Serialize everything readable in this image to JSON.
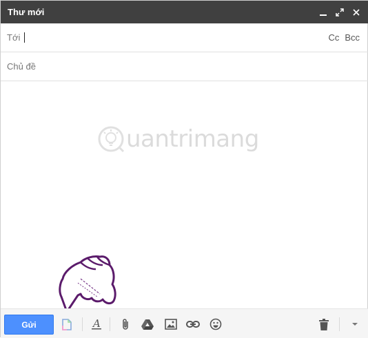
{
  "window": {
    "title": "Thư mới",
    "controls": {
      "minimize_icon": "minimize-icon",
      "popout_icon": "popout-icon",
      "close_icon": "close-icon"
    }
  },
  "compose": {
    "to_label": "Tới",
    "cc_label": "Cc",
    "bcc_label": "Bcc",
    "subject_placeholder": "Chủ đề"
  },
  "watermark": {
    "text": "uantrimang",
    "letter": "Q"
  },
  "toolbar": {
    "send_label": "Gửi",
    "icons": [
      "document-icon",
      "format-text-icon",
      "attach-icon",
      "drive-icon",
      "insert-photo-icon",
      "insert-link-icon",
      "emoji-icon",
      "trash-icon",
      "more-options-icon"
    ]
  },
  "colors": {
    "titlebar": "#404040",
    "send_button": "#4d90fe",
    "hand_outline": "#5b1b6b"
  }
}
